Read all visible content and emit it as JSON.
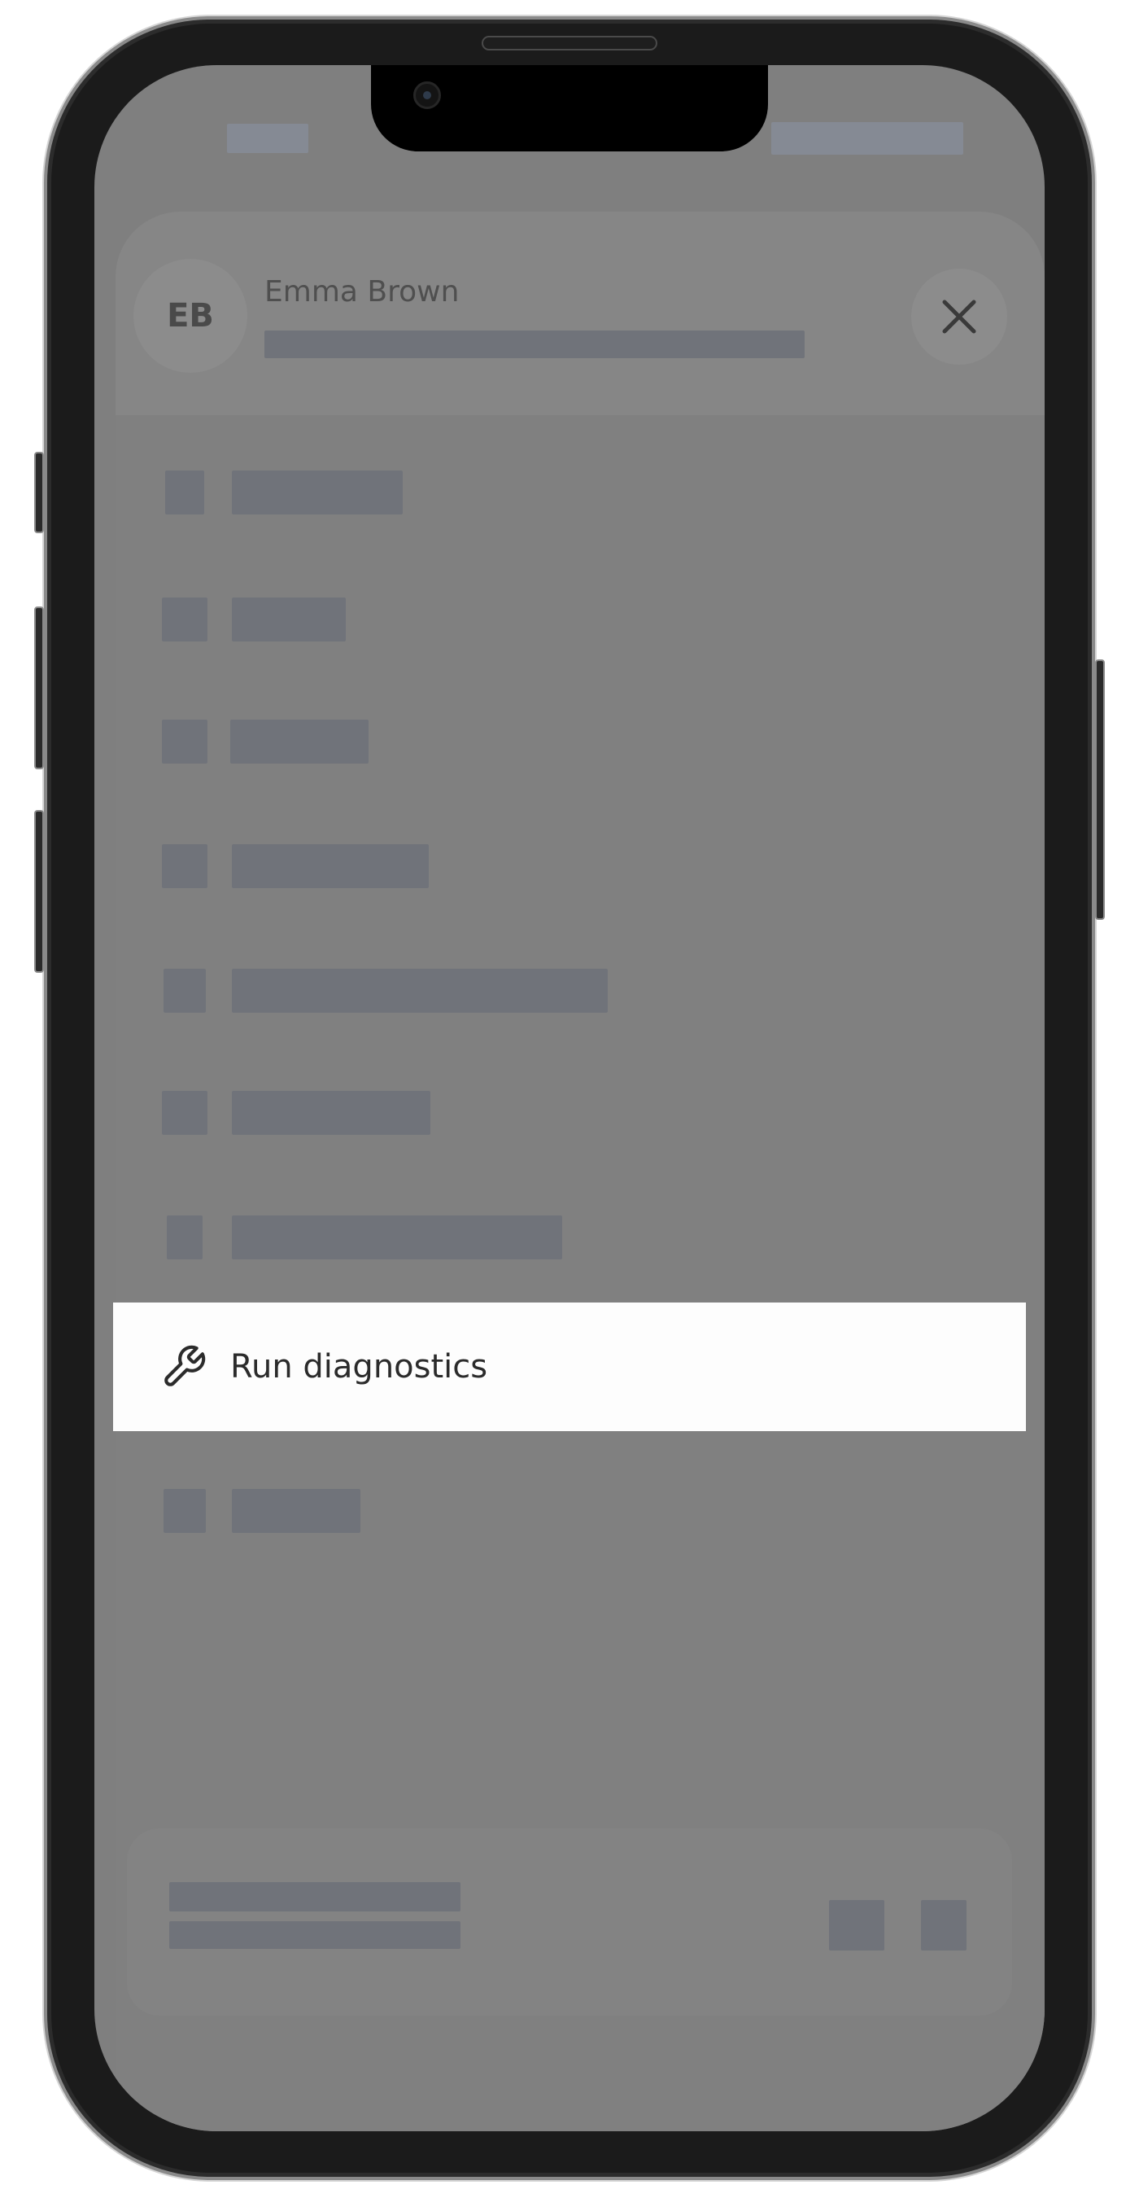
{
  "sheet": {
    "avatar_initials": "EB",
    "user_name": "Emma Brown",
    "close_icon": "close-icon"
  },
  "highlighted_item": {
    "label": "Run diagnostics",
    "icon": "wrench-icon"
  },
  "colors": {
    "overlay": "#7f7f7f",
    "placeholder": "#70737a",
    "highlight_background": "#fdfdfd",
    "highlight_text": "#2b2b2b"
  }
}
